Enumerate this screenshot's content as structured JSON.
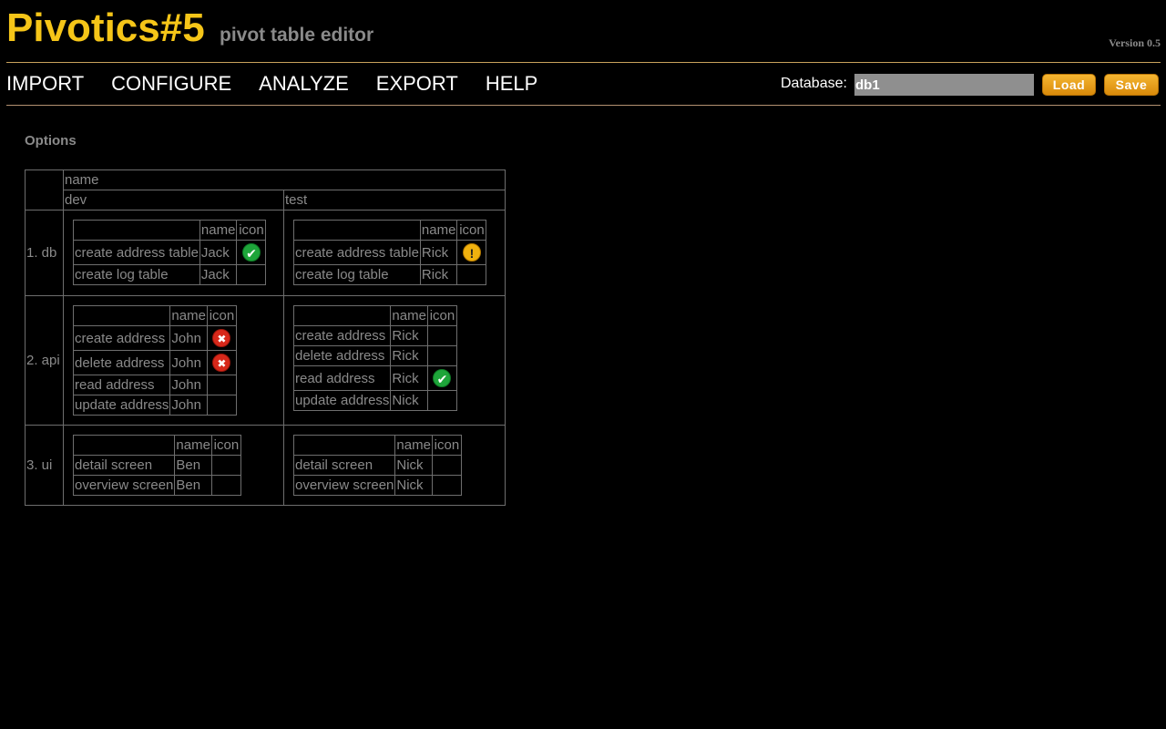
{
  "header": {
    "title": "Pivotics#5",
    "subtitle": "pivot table editor",
    "version": "Version 0.5"
  },
  "menu": {
    "items": [
      {
        "label": "IMPORT"
      },
      {
        "label": "CONFIGURE"
      },
      {
        "label": "ANALYZE"
      },
      {
        "label": "EXPORT"
      },
      {
        "label": "HELP"
      }
    ]
  },
  "database": {
    "label": "Database:",
    "value": "db1",
    "load_label": "Load",
    "save_label": "Save"
  },
  "colors": {
    "accent": "#f5c518",
    "button": "#e8a01a",
    "ok": "#1ea53a",
    "warn": "#f0b10e",
    "error": "#d7281a"
  },
  "options": {
    "heading": "Options",
    "top_header": "name",
    "columns": [
      "dev",
      "test"
    ],
    "inner_headers": {
      "name": "name",
      "icon": "icon"
    },
    "rows": [
      {
        "label": "1. db",
        "cells": [
          [
            {
              "task": "create address table",
              "name": "Jack",
              "icon": "check-icon",
              "status": "ok"
            },
            {
              "task": "create log table",
              "name": "Jack",
              "icon": "",
              "status": ""
            }
          ],
          [
            {
              "task": "create address table",
              "name": "Rick",
              "icon": "warning-icon",
              "status": "warn"
            },
            {
              "task": "create log table",
              "name": "Rick",
              "icon": "",
              "status": ""
            }
          ]
        ]
      },
      {
        "label": "2. api",
        "cells": [
          [
            {
              "task": "create address",
              "name": "John",
              "icon": "error-icon",
              "status": "error"
            },
            {
              "task": "delete address",
              "name": "John",
              "icon": "error-icon",
              "status": "error"
            },
            {
              "task": "read address",
              "name": "John",
              "icon": "",
              "status": ""
            },
            {
              "task": "update address",
              "name": "John",
              "icon": "",
              "status": ""
            }
          ],
          [
            {
              "task": "create address",
              "name": "Rick",
              "icon": "",
              "status": ""
            },
            {
              "task": "delete address",
              "name": "Rick",
              "icon": "",
              "status": ""
            },
            {
              "task": "read address",
              "name": "Rick",
              "icon": "check-icon",
              "status": "ok"
            },
            {
              "task": "update address",
              "name": "Nick",
              "icon": "",
              "status": ""
            }
          ]
        ]
      },
      {
        "label": "3. ui",
        "cells": [
          [
            {
              "task": "detail screen",
              "name": "Ben",
              "icon": "",
              "status": ""
            },
            {
              "task": "overview screen",
              "name": "Ben",
              "icon": "",
              "status": ""
            }
          ],
          [
            {
              "task": "detail screen",
              "name": "Nick",
              "icon": "",
              "status": ""
            },
            {
              "task": "overview screen",
              "name": "Nick",
              "icon": "",
              "status": ""
            }
          ]
        ]
      }
    ]
  }
}
